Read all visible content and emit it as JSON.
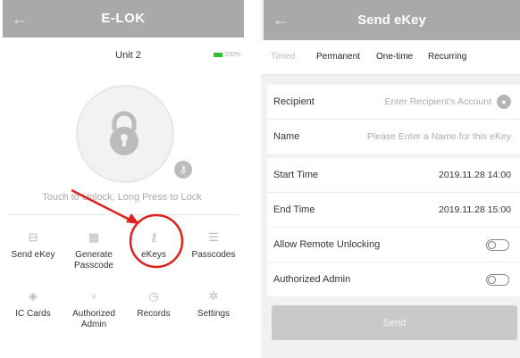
{
  "left": {
    "title": "E-LOK",
    "unit_name": "Unit 2",
    "battery": "100%",
    "hint": "Touch to Unlock, Long Press to Lock",
    "grid": [
      {
        "label": "Send eKey",
        "icon": "send-ekey-icon",
        "glyph": "⊟"
      },
      {
        "label": "Generate\nPasscode",
        "icon": "calculator-icon",
        "glyph": "▦"
      },
      {
        "label": "eKeys",
        "icon": "ekeys-icon",
        "glyph": "⚷"
      },
      {
        "label": "Passcodes",
        "icon": "passcodes-icon",
        "glyph": "☰"
      },
      {
        "label": "IC Cards",
        "icon": "ic-card-icon",
        "glyph": "◈"
      },
      {
        "label": "Authorized\nAdmin",
        "icon": "admin-icon",
        "glyph": "♀"
      },
      {
        "label": "Records",
        "icon": "records-icon",
        "glyph": "◷"
      },
      {
        "label": "Settings",
        "icon": "settings-icon",
        "glyph": "✲"
      }
    ]
  },
  "right": {
    "title": "Send eKey",
    "tabs": [
      "Timed",
      "Permanent",
      "One-time",
      "Recurring"
    ],
    "recipient_label": "Recipient",
    "recipient_placeholder": "Enter Recipient's Account",
    "name_label": "Name",
    "name_placeholder": "Please Enter a Name for this eKey",
    "start_label": "Start Time",
    "start_value": "2019.11.28 14:00",
    "end_label": "End Time",
    "end_value": "2019.11.28 15:00",
    "remote_label": "Allow Remote Unlocking",
    "admin_label": "Authorized Admin",
    "send_label": "Send"
  },
  "colors": {
    "titlebar": "#a9a9a9",
    "annotation": "#e0201c",
    "battery": "#2bc42b"
  }
}
